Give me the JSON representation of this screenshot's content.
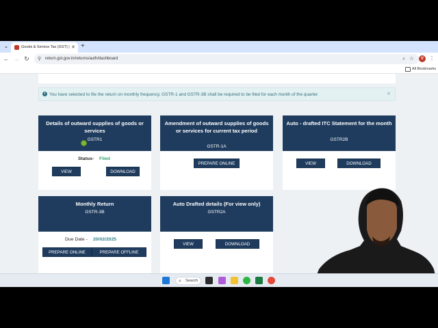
{
  "browser": {
    "tab_title": "Goods & Service Tax (GST) | U",
    "tab_close": "✕",
    "new_tab": "+",
    "url": "return.gst.gov.in/returns/auth/dashboard",
    "profile_initial": "V",
    "bookmarks_label": "All Bookmarks"
  },
  "alert": {
    "info_glyph": "i",
    "message": "You have selected to file the return on monthly frequency, GSTR-1 and GSTR-3B shall be required to be filed for each month of the quarter.",
    "close_glyph": "×"
  },
  "tiles": {
    "gstr1": {
      "title": "Details of outward supplies of goods or services",
      "code": "GSTR1",
      "status_label": "Status-",
      "status_value": "Filed",
      "view": "VIEW",
      "download": "DOWNLOAD"
    },
    "gstr1a": {
      "title": "Amendment of outward supplies of goods or services for current tax period",
      "code": "GSTR-1A",
      "prepare_online": "PREPARE ONLINE"
    },
    "gstr2b": {
      "title": "Auto - drafted ITC Statement for the month",
      "code": "GSTR2B",
      "view": "VIEW",
      "download": "DOWNLOAD"
    },
    "gstr3b": {
      "title": "Monthly Return",
      "code": "GSTR-3B",
      "due_label": "Due Date -",
      "due_value": "20/02/2025",
      "prepare_online": "PREPARE ONLINE",
      "prepare_offline": "PREPARE OFFLINE"
    },
    "gstr2a": {
      "title": "Auto Drafted details (For view only)",
      "code": "GSTR2A",
      "view": "VIEW",
      "download": "DOWNLOAD"
    }
  },
  "taskbar": {
    "search_label": "Search"
  },
  "colors": {
    "tile_header": "#1f3c5e",
    "status_filed": "#2e9d6e",
    "due_date": "#2f7f8a",
    "alert_text": "#2f6f7a"
  }
}
